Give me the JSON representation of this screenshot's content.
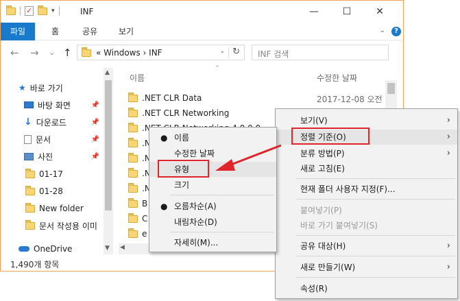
{
  "window": {
    "title": "INF",
    "controls": {
      "minimize": "—",
      "maximize": "☐",
      "close": "✕"
    }
  },
  "ribbon": {
    "tabs": [
      "파일",
      "홈",
      "공유",
      "보기"
    ],
    "help": "?"
  },
  "navigation": {
    "back": "←",
    "forward": "→",
    "recent": "⌄",
    "up": "↑",
    "breadcrumb": "« Windows › INF",
    "search_placeholder": "INF 검색"
  },
  "sidebar": {
    "items": [
      {
        "label": "바로 가기",
        "icon": "star-icon"
      },
      {
        "label": "바탕 화면",
        "icon": "desktop-icon",
        "pinned": true
      },
      {
        "label": "다운로드",
        "icon": "download-icon",
        "pinned": true
      },
      {
        "label": "문서",
        "icon": "document-icon",
        "pinned": true
      },
      {
        "label": "사진",
        "icon": "pictures-icon",
        "pinned": true
      },
      {
        "label": "01-17",
        "icon": "folder-icon"
      },
      {
        "label": "01-28",
        "icon": "folder-icon"
      },
      {
        "label": "New folder",
        "icon": "folder-icon"
      },
      {
        "label": "문서 작성용 이미",
        "icon": "folder-icon"
      },
      {
        "label": "OneDrive",
        "icon": "onedrive-icon"
      }
    ]
  },
  "status": {
    "item_count": "1,490개 항목"
  },
  "file_list": {
    "columns": [
      "이름",
      "수정한 날짜"
    ],
    "rows": [
      {
        "name": ".NET CLR Data",
        "date": "2017-12-08 오전"
      },
      {
        "name": ".NET CLR Networking",
        "date": ""
      },
      {
        "name": ".NET CLR Networking 4.0.0.0",
        "date": ""
      },
      {
        "name": ".N",
        "date": ""
      },
      {
        "name": ".N",
        "date": ""
      },
      {
        "name": ".N",
        "date": ""
      },
      {
        "name": ".N",
        "date": ""
      },
      {
        "name": "B",
        "date": ""
      },
      {
        "name": "C",
        "date": ""
      },
      {
        "name": "e",
        "date": ""
      }
    ]
  },
  "context_menu": {
    "items": [
      {
        "label": "보기(V)",
        "submenu": true
      },
      {
        "label": "정렬 기준(O)",
        "submenu": true,
        "highlighted": true
      },
      {
        "label": "분류 방법(P)",
        "submenu": true
      },
      {
        "label": "새로 고침(E)"
      },
      {
        "label": "현재 폴더 사용자 지정(F)..."
      },
      {
        "label": "붙여넣기(P)",
        "disabled": true
      },
      {
        "label": "바로 가기 붙여넣기(S)",
        "disabled": true
      },
      {
        "label": "공유 대상(H)",
        "submenu": true
      },
      {
        "label": "새로 만들기(W)",
        "submenu": true
      },
      {
        "label": "속성(R)"
      }
    ]
  },
  "sort_submenu": {
    "items": [
      {
        "label": "이름",
        "checked": true
      },
      {
        "label": "수정한 날짜"
      },
      {
        "label": "유형",
        "highlighted": true
      },
      {
        "label": "크기"
      },
      {
        "label": "오름차순(A)",
        "checked": true
      },
      {
        "label": "내림차순(D)"
      },
      {
        "label": "자세히(M)..."
      }
    ]
  },
  "colors": {
    "accent": "#1979ca",
    "annotation": "#e0242b",
    "folder": "#f8d675"
  }
}
